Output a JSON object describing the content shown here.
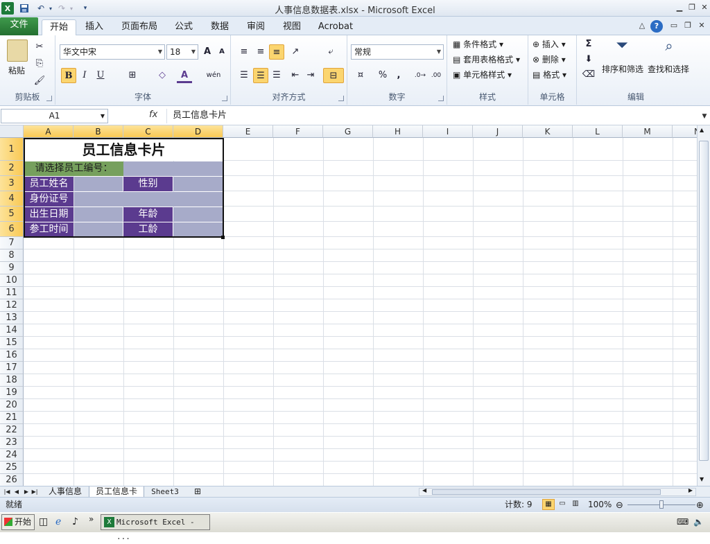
{
  "window": {
    "title": "人事信息数据表.xlsx - Microsoft Excel",
    "min_icon": "minimize-icon",
    "restore_icon": "restore-icon",
    "close_icon": "close-icon"
  },
  "quick_access": {
    "excel_icon": "X",
    "save_icon": "save-icon",
    "undo_icon": "undo-icon",
    "redo_icon": "redo-icon"
  },
  "tabs": [
    "文件",
    "开始",
    "插入",
    "页面布局",
    "公式",
    "数据",
    "审阅",
    "视图",
    "Acrobat"
  ],
  "active_tab": "开始",
  "ribbon": {
    "clipboard": {
      "paste": "粘贴",
      "label": "剪贴板"
    },
    "font": {
      "name": "华文中宋",
      "size": "18",
      "label": "字体",
      "bold": "B",
      "italic": "I",
      "underline": "U",
      "grow": "A",
      "shrink": "A",
      "font_color": "A",
      "wen": "wén"
    },
    "alignment": {
      "label": "对齐方式"
    },
    "number": {
      "format": "常规",
      "label": "数字",
      "percent": "%",
      "comma": ","
    },
    "styles": {
      "conditional": "条件格式",
      "table": "套用表格格式",
      "cell": "单元格样式",
      "label": "样式"
    },
    "cells": {
      "insert": "插入",
      "delete": "删除",
      "format": "格式",
      "label": "单元格"
    },
    "editing": {
      "sum": "Σ",
      "sort": "排序和筛选",
      "find": "查找和选择",
      "label": "编辑"
    }
  },
  "formula_bar": {
    "name_box": "A1",
    "fx": "fx",
    "content": "员工信息卡片"
  },
  "columns": [
    "A",
    "B",
    "C",
    "D",
    "E",
    "F",
    "G",
    "H",
    "I",
    "J",
    "K",
    "L",
    "M",
    "N"
  ],
  "rows": [
    "1",
    "2",
    "3",
    "4",
    "5",
    "6",
    "7",
    "8",
    "9",
    "10",
    "11",
    "12",
    "13",
    "14",
    "15",
    "16",
    "17",
    "18",
    "19",
    "20",
    "21",
    "22",
    "23",
    "24",
    "25",
    "26"
  ],
  "card": {
    "title": "员工信息卡片",
    "prompt": "请选择员工编号：",
    "name_label": "员工姓名",
    "gender_label": "性别",
    "id_label": "身份证号",
    "birth_label": "出生日期",
    "age_label": "年龄",
    "join_label": "参工时间",
    "seniority_label": "工龄"
  },
  "colors": {
    "purple": "#5b3b8f",
    "lavender": "#a7abc9",
    "green": "#76a05d",
    "ribbon_accent": "#fbd56f"
  },
  "sheets": [
    "人事信息",
    "员工信息卡",
    "Sheet3"
  ],
  "active_sheet": "员工信息卡",
  "status": {
    "ready": "就绪",
    "count": "计数: 9",
    "zoom": "100%"
  },
  "taskbar": {
    "start": "开始",
    "item": "Microsoft Excel - ..."
  }
}
